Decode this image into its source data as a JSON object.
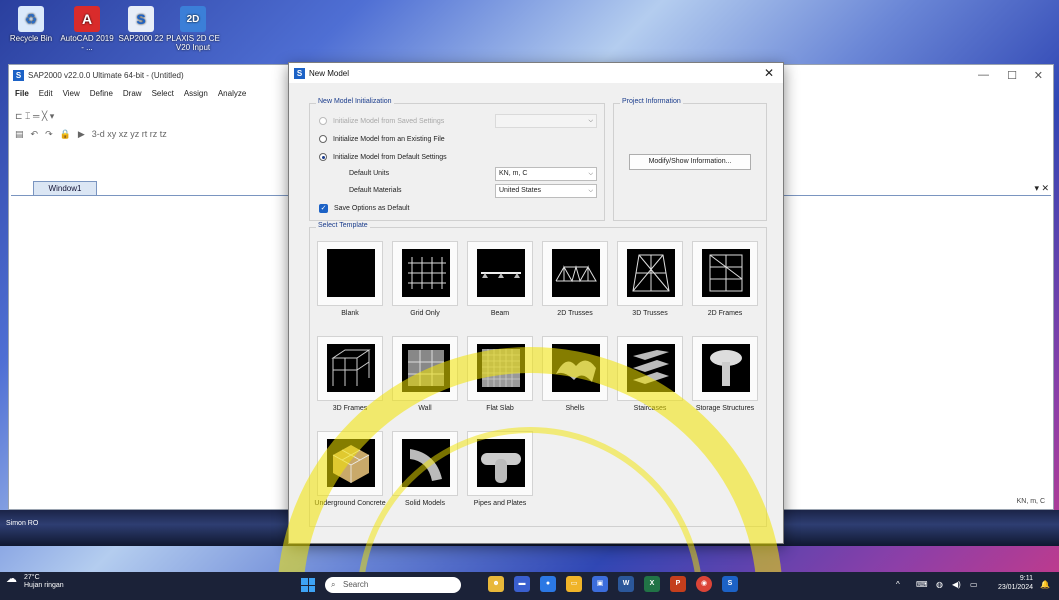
{
  "desktop": {
    "icons": [
      {
        "label": "Recycle Bin",
        "icon": "recycle-bin-icon"
      },
      {
        "label": "AutoCAD 2019 - ...",
        "icon": "autocad-icon"
      },
      {
        "label": "SAP2000 22",
        "icon": "sap2000-icon"
      },
      {
        "label": "PLAXIS 2D CE V20 Input",
        "icon": "plaxis-icon"
      }
    ],
    "colors": {
      "accent": "#1c62c6",
      "title_blue": "#1a3c8c"
    }
  },
  "sap_window": {
    "title": "SAP2000 v22.0.0 Ultimate 64-bit - (Untitled)",
    "menu": [
      "File",
      "Edit",
      "View",
      "Define",
      "Draw",
      "Select",
      "Assign",
      "Analyze"
    ],
    "toolbar_row1": "⊏ ⌶ ═ ╳ ▾",
    "toolbar_row2": "3-d xy xz yz rt rz tz",
    "window_tab": "Window1",
    "status_units": "KN, m, C"
  },
  "dialog": {
    "title": "New Model",
    "init_group": {
      "legend": "New Model Initialization",
      "opt_saved": "Initialize Model from Saved Settings",
      "opt_existing": "Initialize Model from an Existing File",
      "opt_default": "Initialize Model from Default Settings",
      "units_label": "Default Units",
      "units_value": "KN, m, C",
      "materials_label": "Default Materials",
      "materials_value": "United States",
      "save_label": "Save Options as Default"
    },
    "project_group": {
      "legend": "Project Information",
      "button": "Modify/Show Information..."
    },
    "template_group": {
      "legend": "Select Template",
      "items": [
        "Blank",
        "Grid Only",
        "Beam",
        "2D Trusses",
        "3D Trusses",
        "2D Frames",
        "3D Frames",
        "Wall",
        "Flat Slab",
        "Shells",
        "Staircases",
        "Storage Structures",
        "Underground Concrete",
        "Solid Models",
        "Pipes and Plates"
      ]
    }
  },
  "strip_label": "Simon RO",
  "taskbar": {
    "weather_temp": "27°C",
    "weather_desc": "Hujan ringan",
    "search_placeholder": "Search",
    "apps": [
      "W",
      "X",
      "P",
      "S"
    ],
    "time": "9:11",
    "date": "23/01/2024"
  }
}
